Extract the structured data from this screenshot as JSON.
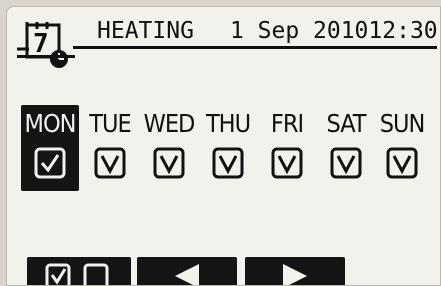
{
  "header": {
    "title": "HEATING",
    "date": "1 Sep 2010",
    "time": "12:30",
    "calendar_day": "7"
  },
  "days": [
    {
      "label": "MON",
      "checked": true,
      "selected": true
    },
    {
      "label": "TUE",
      "checked": true,
      "selected": false
    },
    {
      "label": "WED",
      "checked": true,
      "selected": false
    },
    {
      "label": "THU",
      "checked": true,
      "selected": false
    },
    {
      "label": "FRI",
      "checked": true,
      "selected": false
    },
    {
      "label": "SAT",
      "checked": true,
      "selected": false
    },
    {
      "label": "SUN",
      "checked": true,
      "selected": false
    }
  ],
  "softkeys": {
    "toggle": "checkbox-toggle-icon",
    "prev": "left-arrow-icon",
    "next": "right-arrow-icon"
  }
}
